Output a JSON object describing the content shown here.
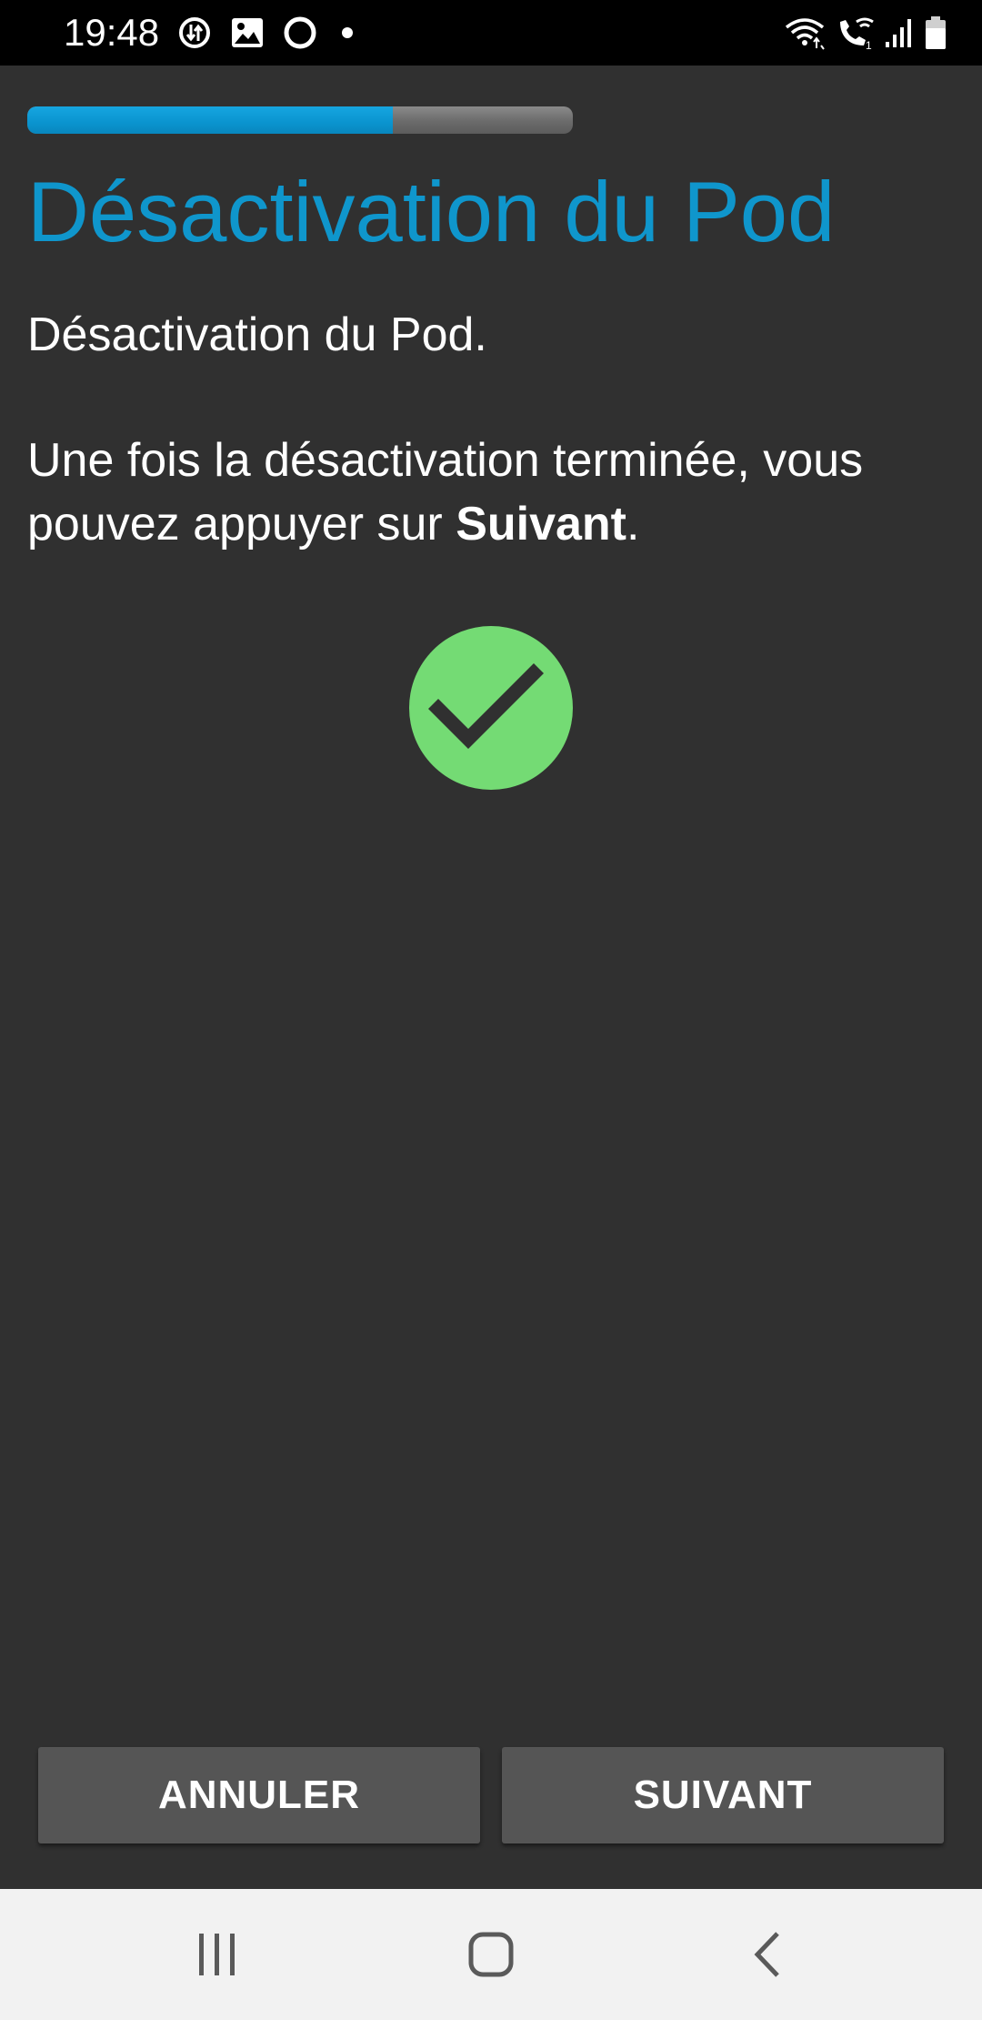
{
  "status_bar": {
    "time": "19:48",
    "left_icons": [
      "data-saver-icon",
      "gallery-icon",
      "circle-notification-icon",
      "dot-icon"
    ],
    "right_icons": [
      "wifi-icon",
      "wifi-call-icon",
      "signal-icon",
      "battery-icon"
    ]
  },
  "progress": {
    "value": 0.67,
    "fill_color": "#0a94cf",
    "track_color": "#6b6b6b"
  },
  "page": {
    "title": "Désactivation du Pod",
    "description_line1": "Désactivation du Pod.",
    "description_line2_prefix": "Une fois la désactivation terminée, vous pouvez appuyer sur ",
    "description_line2_bold": "Suivant",
    "description_line2_suffix": ".",
    "status_icon": "success-check-icon",
    "status_icon_color": "#74db74"
  },
  "actions": {
    "cancel_label": "ANNULER",
    "next_label": "SUIVANT"
  },
  "nav_bar": {
    "buttons": [
      "recents-icon",
      "home-icon",
      "back-icon"
    ]
  },
  "colors": {
    "background": "#303030",
    "title": "#0f96cc",
    "button": "#555555",
    "nav_bar": "#f2f2f2"
  }
}
